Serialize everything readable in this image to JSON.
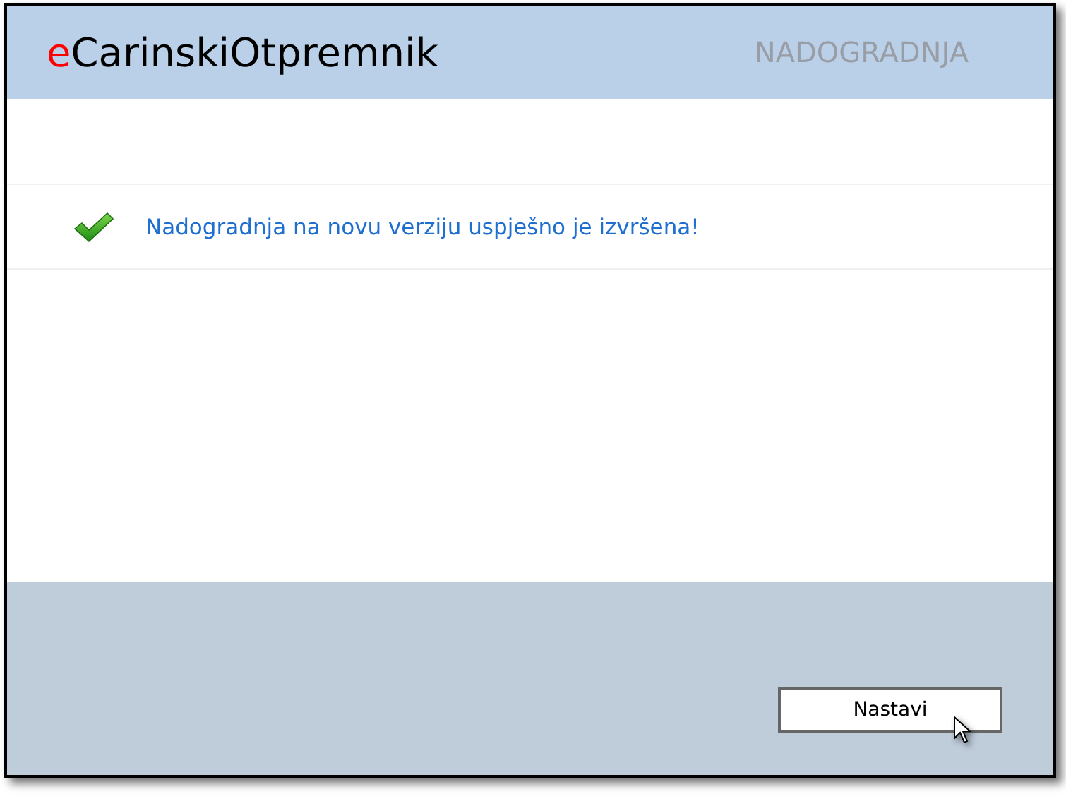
{
  "header": {
    "brand_prefix": "e",
    "brand_name": "CarinskiOtpremnik",
    "section": "NADOGRADNJA"
  },
  "message": {
    "kind": "success",
    "text": "Nadogradnja na novu verziju uspješno je izvršena!"
  },
  "footer": {
    "button": "Nastavi"
  }
}
